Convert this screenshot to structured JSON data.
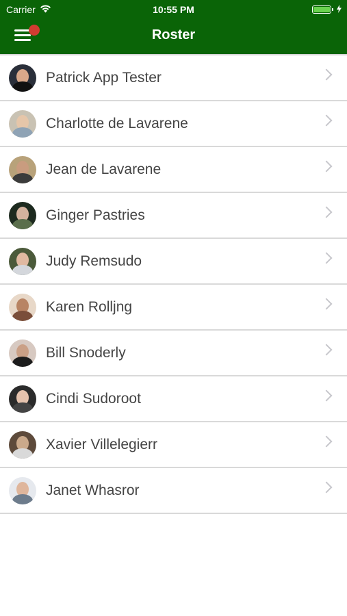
{
  "status_bar": {
    "carrier": "Carrier",
    "time": "10:55 PM"
  },
  "nav": {
    "title": "Roster"
  },
  "roster": [
    {
      "name": "Patrick App Tester"
    },
    {
      "name": "Charlotte de Lavarene"
    },
    {
      "name": "Jean de Lavarene"
    },
    {
      "name": "Ginger Pastries"
    },
    {
      "name": "Judy Remsudo"
    },
    {
      "name": "Karen Rolljng"
    },
    {
      "name": "Bill Snoderly"
    },
    {
      "name": "Cindi Sudoroot"
    },
    {
      "name": "Xavier Villelegierr"
    },
    {
      "name": "Janet Whasror"
    }
  ],
  "colors": {
    "brand": "#0a6407",
    "notification_dot": "#d13c31",
    "battery": "#6ad24f"
  },
  "icons": {
    "menu": "hamburger-menu-icon",
    "wifi": "wifi-icon",
    "battery": "battery-icon",
    "charging": "charging-bolt-icon",
    "chevron": "chevron-right-icon"
  }
}
